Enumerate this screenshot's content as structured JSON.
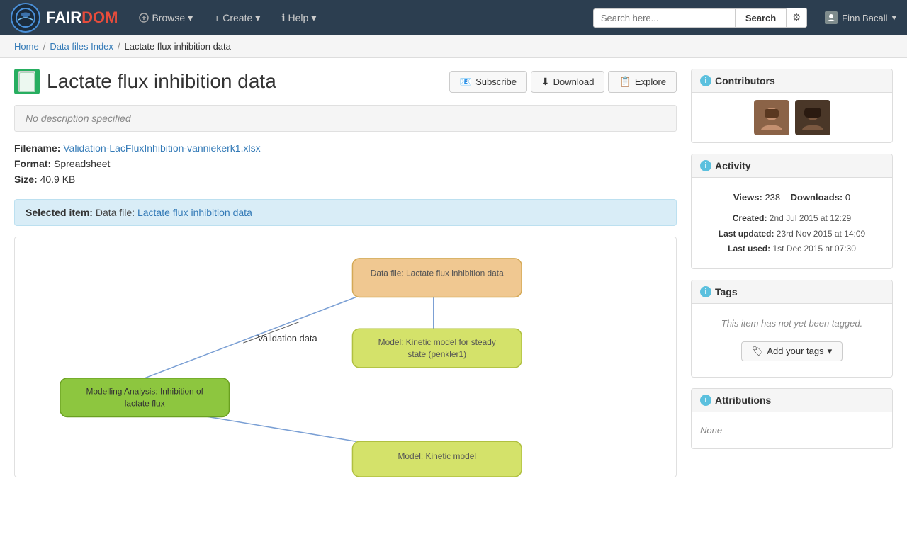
{
  "site": {
    "brand_fair": "FAIR",
    "brand_dom": "DOM",
    "logo_text": "☆"
  },
  "navbar": {
    "browse_label": "Browse",
    "create_label": "+ Create",
    "help_label": "ℹ Help",
    "search_placeholder": "Search here...",
    "search_btn_label": "Search",
    "user_name": "Finn Bacall"
  },
  "breadcrumb": {
    "home": "Home",
    "index": "Data files Index",
    "current": "Lactate flux inhibition data"
  },
  "page": {
    "title": "Lactate flux inhibition data",
    "description": "No description specified",
    "filename_label": "Filename:",
    "filename_value": "Validation-LacFluxInhibition-vanniekerk1.xlsx",
    "format_label": "Format:",
    "format_value": "Spreadsheet",
    "size_label": "Size:",
    "size_value": "40.9 KB"
  },
  "actions": {
    "subscribe": "Subscribe",
    "download": "Download",
    "explore": "Explore"
  },
  "selected_item": {
    "label": "Selected item:",
    "type": "Data file:",
    "name": "Lactate flux inhibition data"
  },
  "diagram": {
    "data_file_node": "Data file: Lactate flux inhibition data",
    "model_node1": "Model: Kinetic model for steady state (penkler1)",
    "modelling_node": "Modelling Analysis: Inhibition of lactate flux",
    "model_node2": "Model: Kinetic model",
    "validation_label": "Validation data"
  },
  "sidebar": {
    "contributors_title": "Contributors",
    "activity_title": "Activity",
    "views_label": "Views:",
    "views_count": "238",
    "downloads_label": "Downloads:",
    "downloads_count": "0",
    "created_label": "Created:",
    "created_value": "2nd Jul 2015 at 12:29",
    "last_updated_label": "Last updated:",
    "last_updated_value": "23rd Nov 2015 at 14:09",
    "last_used_label": "Last used:",
    "last_used_value": "1st Dec 2015 at 07:30",
    "tags_title": "Tags",
    "tags_empty": "This item has not yet been tagged.",
    "add_tags_label": "Add your tags",
    "attributions_title": "Attributions",
    "attributions_none": "None"
  }
}
